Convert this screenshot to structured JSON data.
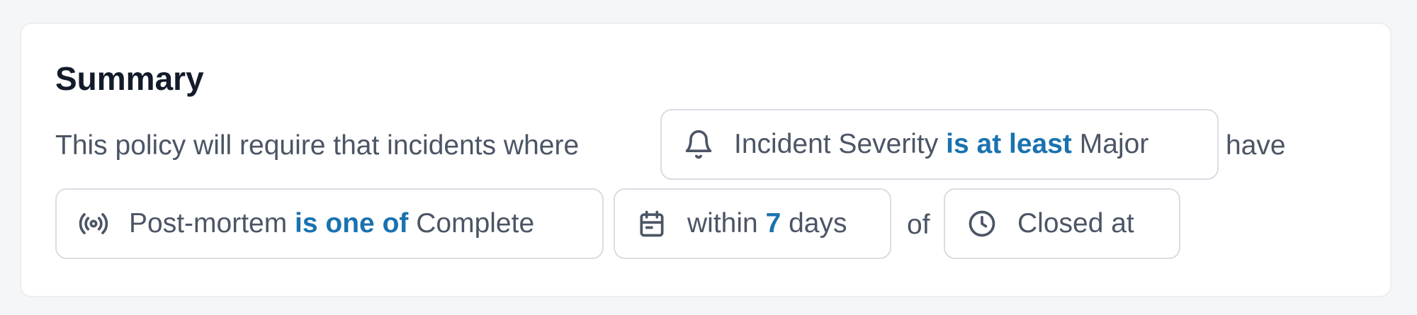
{
  "summary": {
    "title": "Summary",
    "sentence_start": "This policy will require that incidents where",
    "have_word": "have",
    "of_word": "of"
  },
  "conditions": {
    "severity": {
      "icon": "bell-icon",
      "field": "Incident Severity",
      "operator": "is at least",
      "value": "Major"
    },
    "postmortem": {
      "icon": "broadcast-icon",
      "field": "Post-mortem",
      "operator": "is one of",
      "value": "Complete"
    },
    "timeframe": {
      "icon": "calendar-icon",
      "prefix": "within",
      "number": "7",
      "unit": "days"
    },
    "timestamp": {
      "icon": "clock-icon",
      "label": "Closed at"
    }
  },
  "colors": {
    "accent": "#1a72b0",
    "text": "#4b5565",
    "title": "#131b2a",
    "pill_border": "#d9dde3"
  }
}
